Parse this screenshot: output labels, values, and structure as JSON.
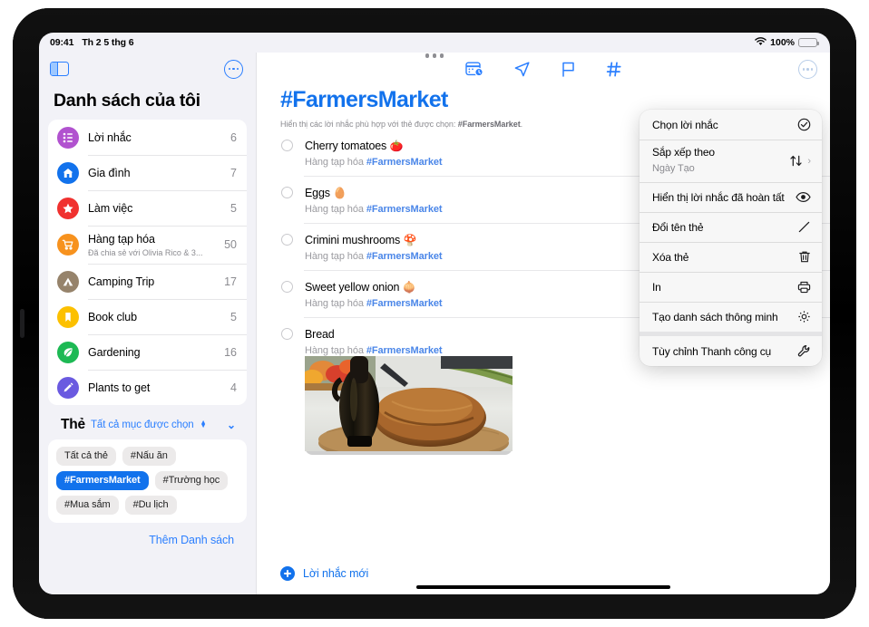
{
  "status_bar": {
    "time": "09:41",
    "date": "Th 2 5 thg 6",
    "wifi_icon": "wifi-icon",
    "battery_percent": "100%"
  },
  "sidebar": {
    "toggle_icon": "sidebar-toggle-icon",
    "more_icon": "more-circle-icon",
    "title": "Danh sách của tôi",
    "lists": [
      {
        "name": "Lời nhắc",
        "count": "6",
        "icon": "bulleted-list-icon",
        "color": "#b152cf",
        "subtitle": ""
      },
      {
        "name": "Gia đình",
        "count": "7",
        "icon": "house-icon",
        "color": "#1272ec",
        "subtitle": ""
      },
      {
        "name": "Làm việc",
        "count": "5",
        "icon": "star-icon",
        "color": "#f0312f",
        "subtitle": ""
      },
      {
        "name": "Hàng tạp hóa",
        "count": "50",
        "icon": "shopping-cart-icon",
        "color": "#f7921e",
        "subtitle": "Đã chia sẻ với Olivia Rico & 3..."
      },
      {
        "name": "Camping Trip",
        "count": "17",
        "icon": "tent-icon",
        "color": "#96836b",
        "subtitle": ""
      },
      {
        "name": "Book club",
        "count": "5",
        "icon": "bookmark-icon",
        "color": "#fcc000",
        "subtitle": ""
      },
      {
        "name": "Gardening",
        "count": "16",
        "icon": "leaf-icon",
        "color": "#1db954",
        "subtitle": ""
      },
      {
        "name": "Plants to get",
        "count": "4",
        "icon": "pencil-icon",
        "color": "#6a5ae0",
        "subtitle": ""
      }
    ],
    "tags_section": {
      "title": "Thẻ",
      "filter_label": "Tất cả mục được chọn",
      "sort_icon": "up-down-arrows-icon",
      "collapse_icon": "chevron-down-icon",
      "chips": [
        {
          "label": "Tất cả thẻ",
          "selected": false
        },
        {
          "label": "#Nấu ăn",
          "selected": false
        },
        {
          "label": "#FarmersMarket",
          "selected": true
        },
        {
          "label": "#Trường học",
          "selected": false
        },
        {
          "label": "#Mua sắm",
          "selected": false
        },
        {
          "label": "#Du lịch",
          "selected": false
        }
      ]
    },
    "add_list_label": "Thêm Danh sách"
  },
  "main": {
    "toolbar_icons": [
      "calendar-clock-icon",
      "location-arrow-icon",
      "flag-icon",
      "hashtag-icon"
    ],
    "more_icon": "more-circle-icon",
    "title": "#FarmersMarket",
    "subtitle_prefix": "Hiển thị các lời nhắc phù hợp với thẻ được chọn: ",
    "subtitle_tag": "#FarmersMarket",
    "subtitle_suffix": ".",
    "reminders": [
      {
        "title": "Cherry tomatoes",
        "emoji": "🍅",
        "list": "Hàng tạp hóa",
        "tag": "#FarmersMarket",
        "has_photo": false
      },
      {
        "title": "Eggs",
        "emoji": "🥚",
        "list": "Hàng tạp hóa",
        "tag": "#FarmersMarket",
        "has_photo": false
      },
      {
        "title": "Crimini mushrooms",
        "emoji": "🍄",
        "list": "Hàng tạp hóa",
        "tag": "#FarmersMarket",
        "has_photo": false
      },
      {
        "title": "Sweet yellow onion",
        "emoji": "🧅",
        "list": "Hàng tạp hóa",
        "tag": "#FarmersMarket",
        "has_photo": false
      },
      {
        "title": "Bread",
        "emoji": "",
        "list": "Hàng tạp hóa",
        "tag": "#FarmersMarket",
        "has_photo": true,
        "photo_description": "Loaf of rustic bread and dark oil bottle on wooden board"
      }
    ],
    "new_reminder_label": "Lời nhắc mới"
  },
  "context_menu": {
    "items": [
      {
        "label": "Chọn lời nhắc",
        "sub": "",
        "icon": "checkmark-circle-icon",
        "chevron": false,
        "group_start": false
      },
      {
        "label": "Sắp xếp theo",
        "sub": "Ngày Tạo",
        "icon": "up-down-arrows-icon",
        "chevron": true,
        "group_start": false
      },
      {
        "label": "Hiển thị lời nhắc đã hoàn tất",
        "sub": "",
        "icon": "eye-icon",
        "chevron": false,
        "group_start": false
      },
      {
        "label": "Đổi tên thẻ",
        "sub": "",
        "icon": "pencil-icon",
        "chevron": false,
        "group_start": false
      },
      {
        "label": "Xóa thẻ",
        "sub": "",
        "icon": "trash-icon",
        "chevron": false,
        "group_start": false
      },
      {
        "label": "In",
        "sub": "",
        "icon": "printer-icon",
        "chevron": false,
        "group_start": false
      },
      {
        "label": "Tạo danh sách thông minh",
        "sub": "",
        "icon": "gear-icon",
        "chevron": false,
        "group_start": false
      },
      {
        "label": "Tùy chỉnh Thanh công cụ",
        "sub": "",
        "icon": "wrench-icon",
        "chevron": false,
        "group_start": true
      }
    ]
  },
  "colors": {
    "accent_blue": "#1272ec",
    "tint_blue": "#2b7fff",
    "background": "#f2f2f7",
    "card": "#ffffff"
  }
}
